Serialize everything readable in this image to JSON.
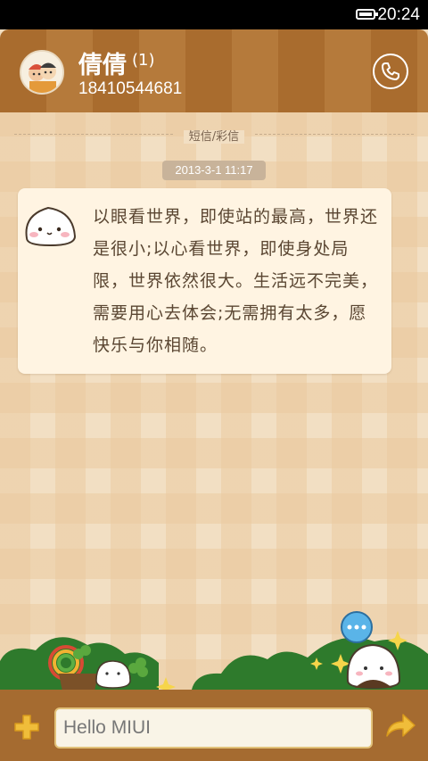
{
  "status_bar": {
    "time": "20:24",
    "battery_icon": "battery-icon"
  },
  "header": {
    "contact_name": "倩倩",
    "unread_count": "(1)",
    "phone_number": "18410544681",
    "call_icon": "phone-icon"
  },
  "conversation": {
    "channel_label": "短信/彩信",
    "timestamp": "2013-3-1 11:17",
    "messages": [
      {
        "text": "以眼看世界，即使站的最高，世界还是很小;以心看世界，即使身处局限，世界依然很大。生活远不完美，需要用心去体会;无需拥有太多，愿快乐与你相随。"
      }
    ]
  },
  "composer": {
    "input_value": "",
    "placeholder": "Hello MIUI",
    "attach_icon": "plus-icon",
    "send_icon": "send-arrow-icon"
  },
  "colors": {
    "header_stripe_dark": "#a96c2e",
    "header_stripe_light": "#b57a3b",
    "chat_background": "#f2dfc3",
    "bubble": "#fff4e2",
    "input_bar": "#a56b30",
    "accent_yellow": "#f0bd3a",
    "grass": "#2e7a2c"
  }
}
